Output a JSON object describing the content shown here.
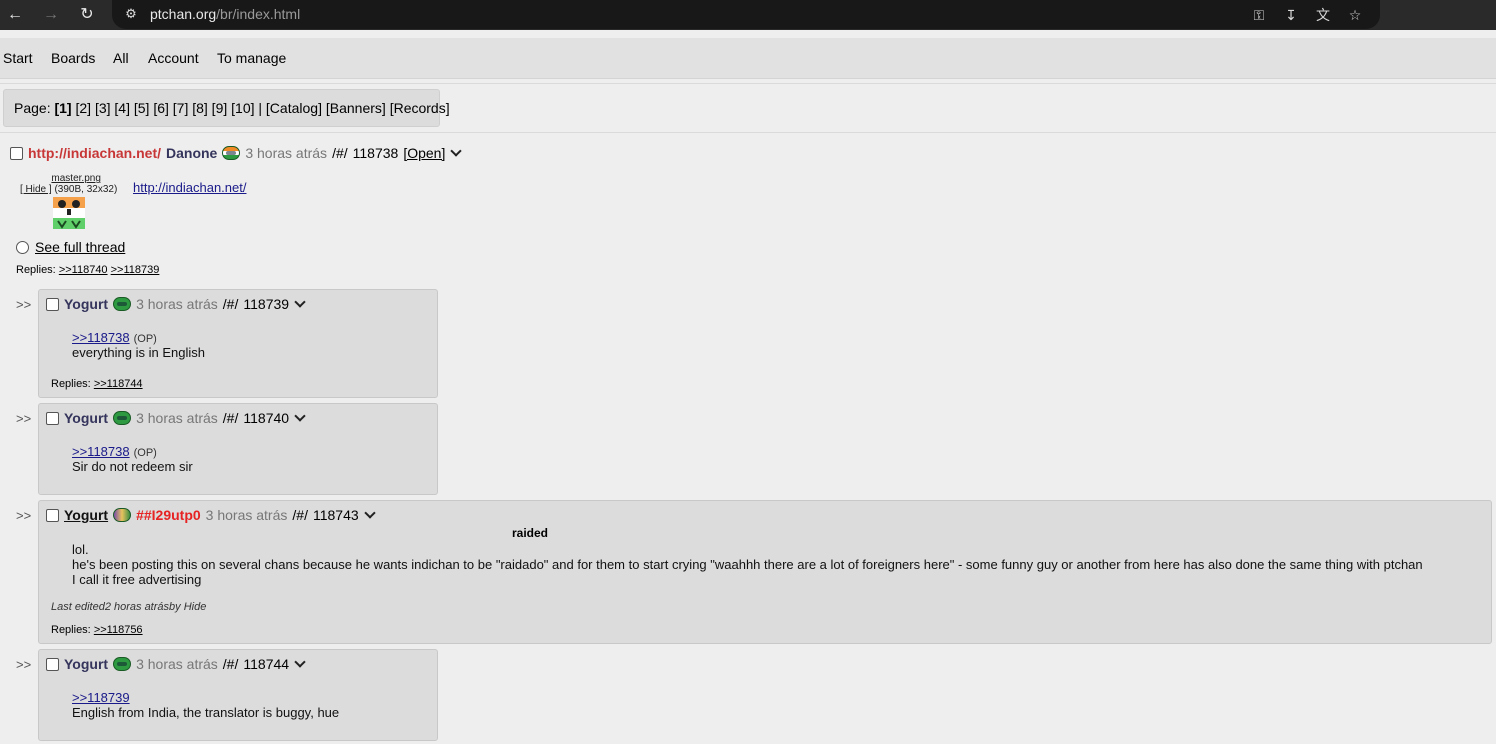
{
  "browser": {
    "url_host": "ptchan.org",
    "url_path": "/br/index.html"
  },
  "nav": [
    "Start",
    "Boards",
    "All",
    "Account",
    "To manage"
  ],
  "pager": {
    "label": "Page:",
    "current": "[1]",
    "pages": "[2] [3] [4] [5] [6] [7] [8] [9] [10] |",
    "catalog": "[Catalog]",
    "banners": "[Banners]",
    "records": "[Records]"
  },
  "op": {
    "subject": "http://indiachan.net/",
    "name": "Danone",
    "time": "3 horas atrás",
    "board_link": "/#/",
    "number": "118738",
    "open": "[Open]",
    "file_name": "master.png",
    "file_hide": "[ Hide ]",
    "file_meta": "(390B, 32x32)",
    "body_link": "http://indiachan.net/",
    "see_full": "See full thread",
    "replies_label": "Replies:",
    "replies": [
      ">>118740",
      ">>118739"
    ]
  },
  "posts": [
    {
      "name": "Yogurt",
      "time": "3 horas atrás",
      "board_link": "/#/",
      "number": "118739",
      "quote": ">>118738",
      "op_tag": "(OP)",
      "lines": [
        "everything is in English"
      ],
      "replies_label": "Replies:",
      "replies": [
        ">>118744"
      ]
    },
    {
      "name": "Yogurt",
      "time": "3 horas atrás",
      "board_link": "/#/",
      "number": "118740",
      "quote": ">>118738",
      "op_tag": "(OP)",
      "lines": [
        "Sir do not redeem sir"
      ]
    },
    {
      "name": "Yogurt",
      "tripcode": "##I29utp0",
      "time": "3 horas atrás",
      "board_link": "/#/",
      "number": "118743",
      "heading": "raided",
      "lines": [
        "lol.",
        "he's been posting this on several chans because he wants indichan to be \"raidado\" and for them to start crying \"waahhh there are a lot of foreigners here\" - some funny guy or another from here has also done the same thing with ptchan",
        "I call it free advertising"
      ],
      "edited": "Last edited2 horas atrásby Hide",
      "replies_label": "Replies:",
      "replies": [
        ">>118756"
      ]
    },
    {
      "name": "Yogurt",
      "time": "3 horas atrás",
      "board_link": "/#/",
      "number": "118744",
      "quote": ">>118739",
      "lines": [
        "English from India, the translator is buggy, hue"
      ]
    }
  ]
}
